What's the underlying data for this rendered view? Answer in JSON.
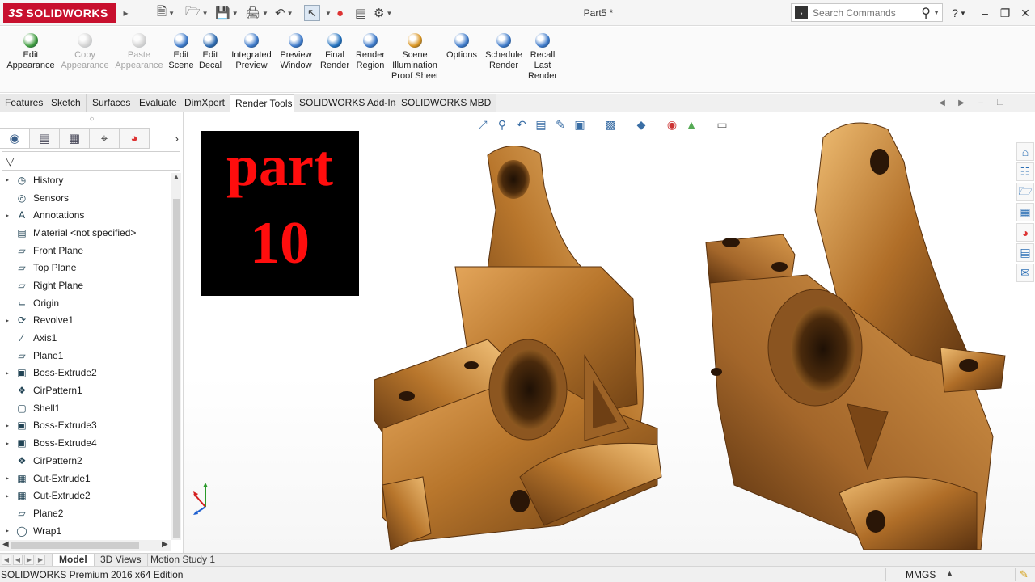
{
  "app": {
    "logo_text": "SOLIDWORKS",
    "document_title": "Part5 *",
    "search_placeholder": "Search Commands",
    "help_label": "?"
  },
  "quick_access": [
    {
      "icon": "new-document-icon"
    },
    {
      "icon": "open-folder-icon"
    },
    {
      "icon": "save-icon"
    },
    {
      "icon": "print-icon"
    },
    {
      "icon": "undo-icon"
    },
    {
      "icon": "select-cursor-icon"
    },
    {
      "icon": "rebuild-traffic-light-icon"
    },
    {
      "icon": "file-properties-icon"
    },
    {
      "icon": "options-gear-icon"
    }
  ],
  "command_manager": {
    "buttons": [
      {
        "label": "Edit\nAppearance",
        "icon": "edit-appearance-icon",
        "enabled": true
      },
      {
        "label": "Copy\nAppearance",
        "icon": "copy-appearance-icon",
        "enabled": false
      },
      {
        "label": "Paste\nAppearance",
        "icon": "paste-appearance-icon",
        "enabled": false
      },
      {
        "label": "Edit\nScene",
        "icon": "edit-scene-icon",
        "enabled": true
      },
      {
        "label": "Edit\nDecal",
        "icon": "edit-decal-icon",
        "enabled": true
      },
      {
        "label": "Integrated\nPreview",
        "icon": "integrated-preview-icon",
        "enabled": true
      },
      {
        "label": "Preview\nWindow",
        "icon": "preview-window-icon",
        "enabled": true
      },
      {
        "label": "Final\nRender",
        "icon": "final-render-icon",
        "enabled": true
      },
      {
        "label": "Render\nRegion",
        "icon": "render-region-icon",
        "enabled": true
      },
      {
        "label": "Scene\nIllumination\nProof Sheet",
        "icon": "scene-illumination-icon",
        "enabled": true
      },
      {
        "label": "Options",
        "icon": "render-options-icon",
        "enabled": true
      },
      {
        "label": "Schedule\nRender",
        "icon": "schedule-render-icon",
        "enabled": true
      },
      {
        "label": "Recall\nLast\nRender",
        "icon": "recall-render-icon",
        "enabled": true
      }
    ]
  },
  "tabs": [
    {
      "label": "Features",
      "active": false
    },
    {
      "label": "Sketch",
      "active": false
    },
    {
      "label": "Surfaces",
      "active": false
    },
    {
      "label": "Evaluate",
      "active": false
    },
    {
      "label": "DimXpert",
      "active": false
    },
    {
      "label": "Render Tools",
      "active": true
    },
    {
      "label": "SOLIDWORKS Add-Ins",
      "active": false
    },
    {
      "label": "SOLIDWORKS MBD",
      "active": false
    }
  ],
  "feature_tree": {
    "panel_tabs": [
      "featuremanager-icon",
      "propertymanager-icon",
      "configurationmanager-icon",
      "dimxpert-icon",
      "display-manager-icon"
    ],
    "items": [
      {
        "label": "History",
        "expandable": true,
        "icon": "history-icon"
      },
      {
        "label": "Sensors",
        "expandable": false,
        "icon": "sensors-icon"
      },
      {
        "label": "Annotations",
        "expandable": true,
        "icon": "annotations-icon"
      },
      {
        "label": "Material <not specified>",
        "expandable": false,
        "icon": "material-icon"
      },
      {
        "label": "Front Plane",
        "expandable": false,
        "icon": "plane-icon"
      },
      {
        "label": "Top Plane",
        "expandable": false,
        "icon": "plane-icon"
      },
      {
        "label": "Right Plane",
        "expandable": false,
        "icon": "plane-icon"
      },
      {
        "label": "Origin",
        "expandable": false,
        "icon": "origin-icon"
      },
      {
        "label": "Revolve1",
        "expandable": true,
        "icon": "revolve-icon"
      },
      {
        "label": "Axis1",
        "expandable": false,
        "icon": "axis-icon"
      },
      {
        "label": "Plane1",
        "expandable": false,
        "icon": "plane-icon"
      },
      {
        "label": "Boss-Extrude2",
        "expandable": true,
        "icon": "extrude-icon"
      },
      {
        "label": "CirPattern1",
        "expandable": false,
        "icon": "circular-pattern-icon"
      },
      {
        "label": "Shell1",
        "expandable": false,
        "icon": "shell-icon"
      },
      {
        "label": "Boss-Extrude3",
        "expandable": true,
        "icon": "extrude-icon"
      },
      {
        "label": "Boss-Extrude4",
        "expandable": true,
        "icon": "extrude-icon"
      },
      {
        "label": "CirPattern2",
        "expandable": false,
        "icon": "circular-pattern-icon"
      },
      {
        "label": "Cut-Extrude1",
        "expandable": true,
        "icon": "cut-extrude-icon"
      },
      {
        "label": "Cut-Extrude2",
        "expandable": true,
        "icon": "cut-extrude-icon"
      },
      {
        "label": "Plane2",
        "expandable": false,
        "icon": "plane-icon"
      },
      {
        "label": "Wrap1",
        "expandable": true,
        "icon": "wrap-icon"
      }
    ]
  },
  "overlay": {
    "line1": "part",
    "line2": "10",
    "color": "#ff0d0d"
  },
  "bottom_tabs": [
    {
      "label": "Model",
      "active": true
    },
    {
      "label": "3D Views",
      "active": false
    },
    {
      "label": "Motion Study 1",
      "active": false
    }
  ],
  "status_bar": {
    "edition": "SOLIDWORKS Premium 2016 x64 Edition",
    "units": "MMGS"
  },
  "colors": {
    "brand_red": "#c8102e",
    "part_bronze": "#b8782e",
    "accent_blue": "#2c6fb5"
  }
}
